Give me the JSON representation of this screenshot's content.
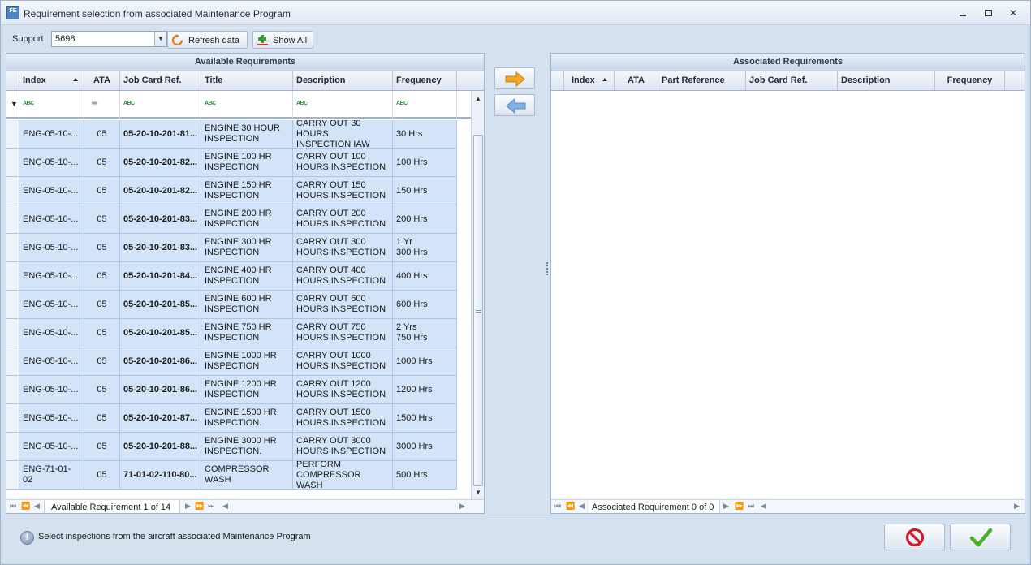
{
  "window": {
    "title": "Requirement selection from associated Maintenance Program",
    "app_icon_text": "FE",
    "controls": {
      "minimize": "▭",
      "maximize": "▢",
      "close": "✕"
    }
  },
  "toolbar": {
    "support_label": "Support",
    "support_value": "5698",
    "refresh_label": "Refresh data",
    "show_all_label": "Show All"
  },
  "available": {
    "title": "Available Requirements",
    "columns": [
      "Index",
      "ATA",
      "Job Card Ref.",
      "Title",
      "Description",
      "Frequency"
    ],
    "rows": [
      {
        "index": "ENG-05-10-...",
        "ata": "05",
        "job_card": "05-20-10-201-81...",
        "title": "ENGINE 30 HOUR\nINSPECTION",
        "description": "CARRY OUT 30 HOURS\nINSPECTION IAW",
        "frequency": "30 Hrs"
      },
      {
        "index": "ENG-05-10-...",
        "ata": "05",
        "job_card": "05-20-10-201-82...",
        "title": "ENGINE 100 HR\nINSPECTION",
        "description": "CARRY OUT 100\nHOURS INSPECTION",
        "frequency": "100 Hrs"
      },
      {
        "index": "ENG-05-10-...",
        "ata": "05",
        "job_card": "05-20-10-201-82...",
        "title": "ENGINE 150 HR\nINSPECTION",
        "description": "CARRY OUT 150\nHOURS INSPECTION",
        "frequency": "150 Hrs"
      },
      {
        "index": "ENG-05-10-...",
        "ata": "05",
        "job_card": "05-20-10-201-83...",
        "title": "ENGINE 200 HR\nINSPECTION",
        "description": "CARRY OUT 200\nHOURS INSPECTION",
        "frequency": "200 Hrs"
      },
      {
        "index": "ENG-05-10-...",
        "ata": "05",
        "job_card": "05-20-10-201-83...",
        "title": "ENGINE 300 HR\nINSPECTION",
        "description": "CARRY OUT 300\nHOURS INSPECTION",
        "frequency": "1 Yr\n300 Hrs"
      },
      {
        "index": "ENG-05-10-...",
        "ata": "05",
        "job_card": "05-20-10-201-84...",
        "title": "ENGINE 400 HR\nINSPECTION",
        "description": "CARRY OUT 400\nHOURS INSPECTION",
        "frequency": "400 Hrs"
      },
      {
        "index": "ENG-05-10-...",
        "ata": "05",
        "job_card": "05-20-10-201-85...",
        "title": "ENGINE 600 HR\nINSPECTION",
        "description": "CARRY OUT 600\nHOURS INSPECTION",
        "frequency": "600 Hrs"
      },
      {
        "index": "ENG-05-10-...",
        "ata": "05",
        "job_card": "05-20-10-201-85...",
        "title": "ENGINE 750 HR\nINSPECTION",
        "description": "CARRY OUT 750\nHOURS INSPECTION",
        "frequency": "2 Yrs\n750 Hrs"
      },
      {
        "index": "ENG-05-10-...",
        "ata": "05",
        "job_card": "05-20-10-201-86...",
        "title": "ENGINE 1000 HR\nINSPECTION",
        "description": "CARRY OUT 1000\nHOURS INSPECTION",
        "frequency": "1000 Hrs"
      },
      {
        "index": "ENG-05-10-...",
        "ata": "05",
        "job_card": "05-20-10-201-86...",
        "title": "ENGINE 1200 HR\nINSPECTION",
        "description": "CARRY OUT 1200\nHOURS INSPECTION",
        "frequency": "1200 Hrs"
      },
      {
        "index": "ENG-05-10-...",
        "ata": "05",
        "job_card": "05-20-10-201-87...",
        "title": "ENGINE 1500 HR\nINSPECTION.",
        "description": "CARRY OUT 1500\nHOURS INSPECTION",
        "frequency": "1500 Hrs"
      },
      {
        "index": "ENG-05-10-...",
        "ata": "05",
        "job_card": "05-20-10-201-88...",
        "title": "ENGINE 3000 HR\nINSPECTION.",
        "description": "CARRY OUT 3000\nHOURS INSPECTION",
        "frequency": "3000 Hrs"
      },
      {
        "index": "ENG-71-01-02",
        "ata": "05",
        "job_card": "71-01-02-110-80...",
        "title": "COMPRESSOR\nWASH",
        "description": "PERFORM\nCOMPRESSOR WASH",
        "frequency": "500 Hrs"
      }
    ],
    "nav_text": "Available Requirement 1 of 14"
  },
  "associated": {
    "title": "Associated Requirements",
    "columns": [
      "Index",
      "ATA",
      "Part Reference",
      "Job Card Ref.",
      "Description",
      "Frequency"
    ],
    "nav_text": "Associated Requirement 0 of 0"
  },
  "footer": {
    "info_text": "Select inspections from the aircraft associated Maintenance Program"
  },
  "colors": {
    "row_selected": "#d3e4f8",
    "accent_arrow": "#f5a623",
    "cancel": "#d11a2a",
    "ok": "#4caf2a"
  }
}
